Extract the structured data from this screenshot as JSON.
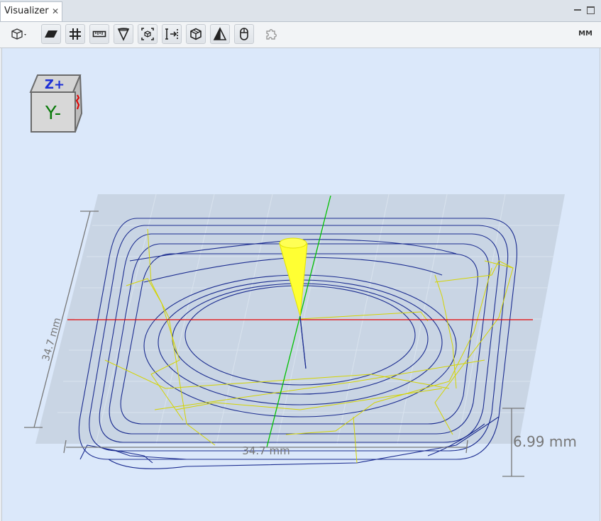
{
  "tab": {
    "label": "Visualizer",
    "close_glyph": "✕"
  },
  "window_controls": [
    "minimize-icon",
    "maximize-icon"
  ],
  "toolbar": {
    "units": "MM",
    "buttons": [
      {
        "name": "view-cube-dropdown",
        "icon": "cube-view-icon"
      },
      {
        "name": "toggle-stock-plane",
        "icon": "plane-icon"
      },
      {
        "name": "toggle-grid",
        "icon": "grid-icon"
      },
      {
        "name": "toggle-ruler",
        "icon": "ruler-icon"
      },
      {
        "name": "toggle-tool",
        "icon": "tool-cone-icon"
      },
      {
        "name": "toggle-bounding-box",
        "icon": "bounding-box-icon"
      },
      {
        "name": "toggle-dimensions",
        "icon": "dimension-icon"
      },
      {
        "name": "toggle-model",
        "icon": "model-cube-icon"
      },
      {
        "name": "toggle-axes",
        "icon": "axes-triangle-icon"
      },
      {
        "name": "toggle-mouse-controls",
        "icon": "mouse-icon"
      },
      {
        "name": "toggle-puzzle",
        "icon": "puzzle-icon"
      }
    ]
  },
  "orientation_cube": {
    "top_label": "Z+",
    "front_label": "Y-"
  },
  "dimensions": {
    "width": "34.7 mm",
    "depth": "34.7 mm",
    "height": "6.99 mm"
  },
  "colors": {
    "viewport_bg": "#dbe8fa",
    "grid_plane": "#c5d1df",
    "toolpath": "#1a2b8f",
    "rapid": "#d4d400",
    "x_axis": "#e00000",
    "y_axis": "#00c000",
    "tool": "#ffff33"
  }
}
